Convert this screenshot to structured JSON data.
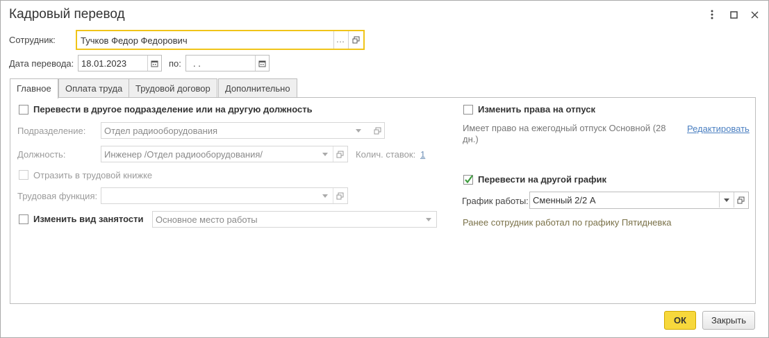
{
  "window": {
    "title": "Кадровый перевод"
  },
  "header": {
    "employee_label": "Сотрудник:",
    "employee_value": "Тучков Федор Федорович",
    "date_label": "Дата перевода:",
    "date_value": "18.01.2023",
    "to_label": "по:",
    "to_value": " .  ."
  },
  "tabs": [
    {
      "label": "Главное",
      "active": true
    },
    {
      "label": "Оплата труда"
    },
    {
      "label": "Трудовой договор"
    },
    {
      "label": "Дополнительно"
    }
  ],
  "left": {
    "transfer_checkbox_label": "Перевести в другое подразделение или на другую должность",
    "department_label": "Подразделение:",
    "department_value": "Отдел радиооборудования",
    "position_label": "Должность:",
    "position_value": "Инженер /Отдел радиооборудования/",
    "rates_label": "Колич. ставок:",
    "rates_value": "1",
    "workbook_label": "Отразить в трудовой книжке",
    "labor_function_label": "Трудовая функция:",
    "labor_function_value": "",
    "employment_type_label": "Изменить вид занятости",
    "employment_type_value": "Основное место работы"
  },
  "right": {
    "vacation_label": "Изменить права на отпуск",
    "vacation_note": "Имеет право на ежегодный отпуск Основной (28 дн.)",
    "edit_link": "Редактировать",
    "schedule_checkbox_label": "Перевести на другой график",
    "schedule_checked": true,
    "schedule_label": "График работы:",
    "schedule_value": "Сменный 2/2 А",
    "schedule_note": "Ранее сотрудник работал по графику Пятидневка"
  },
  "footer": {
    "ok_label": "ОК",
    "close_label": "Закрыть"
  },
  "colors": {
    "accent": "#f7d83c",
    "focus": "#f0c419",
    "link": "#4a7fc1",
    "check": "#3f9d3f"
  }
}
